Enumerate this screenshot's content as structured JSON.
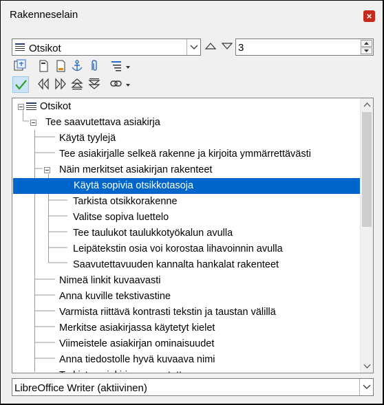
{
  "window": {
    "title": "Rakenneselain",
    "close_label": "×"
  },
  "category_select": {
    "value": "Otsikot"
  },
  "level_spin": {
    "value": "3"
  },
  "tree": {
    "rows": [
      {
        "label": "Otsikot",
        "level": 0,
        "expander": true
      },
      {
        "label": "Tee saavutettava asiakirja",
        "level": 1,
        "expander": true
      },
      {
        "label": "Käytä tyylejä",
        "level": 2
      },
      {
        "label": "Tee asiakirjalle selkeä rakenne ja kirjoita ymmärrettävästi",
        "level": 2
      },
      {
        "label": "Näin merkitset asiakirjan rakenteet",
        "level": 2,
        "expander": true
      },
      {
        "label": "Käytä sopivia otsikkotasoja",
        "level": 3,
        "selected": true
      },
      {
        "label": "Tarkista otsikkorakenne",
        "level": 3
      },
      {
        "label": "Valitse sopiva luettelo",
        "level": 3
      },
      {
        "label": "Tee taulukot taulukkotyökalun avulla",
        "level": 3
      },
      {
        "label": "Leipätekstin osia voi korostaa lihavoinnin avulla",
        "level": 3
      },
      {
        "label": "Saavutettavuuden kannalta hankalat rakenteet",
        "level": 3
      },
      {
        "label": "Nimeä linkit kuvaavasti",
        "level": 2
      },
      {
        "label": "Anna kuville tekstivastine",
        "level": 2
      },
      {
        "label": "Varmista riittävä kontrasti tekstin ja taustan välillä",
        "level": 2
      },
      {
        "label": "Merkitse asiakirjassa käytetyt kielet",
        "level": 2
      },
      {
        "label": "Viimeistele asiakirjan ominaisuudet",
        "level": 2
      },
      {
        "label": "Anna tiedostolle hyvä kuvaava nimi",
        "level": 2
      },
      {
        "label": "Tarkista asiakirjan saavutettavuus",
        "level": 2
      }
    ]
  },
  "document_select": {
    "value": "LibreOffice Writer (aktiivinen)"
  },
  "colors": {
    "selection": "#0066cc",
    "check": "#2aa02a"
  }
}
